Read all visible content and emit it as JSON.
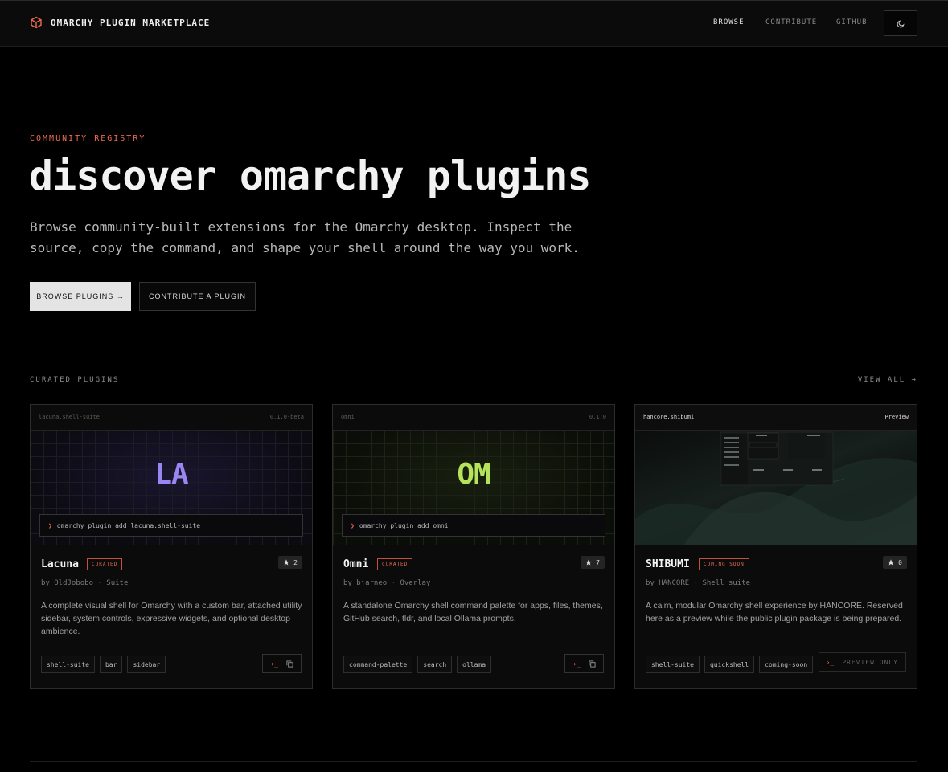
{
  "header": {
    "brand": "OMARCHY PLUGIN MARKETPLACE",
    "nav": [
      "BROWSE",
      "CONTRIBUTE",
      "GITHUB"
    ],
    "theme_toggle_icon": "moon-icon"
  },
  "hero": {
    "eyebrow": "COMMUNITY REGISTRY",
    "title": "discover omarchy plugins",
    "subtitle": "Browse community-built extensions for the Omarchy desktop. Inspect the source, copy the command, and shape your shell around the way you work.",
    "primary_button": "BROWSE PLUGINS →",
    "secondary_button": "CONTRIBUTE A PLUGIN"
  },
  "section": {
    "label": "CURATED PLUGINS",
    "view_all": "VIEW ALL →"
  },
  "plugins": [
    {
      "id": "lacuna.shell-suite",
      "version": "0.1.0-beta",
      "monogram": "LA",
      "monogram_color": "#9a86f2",
      "command": "omarchy plugin add lacuna.shell-suite",
      "prompt": "❯",
      "name": "Lacuna",
      "badge": "CURATED",
      "stars": "2",
      "byline": "by OldJobobo · Suite",
      "description": "A complete visual shell for Omarchy with a custom bar, attached utility sidebar, system controls, expressive widgets, and optional desktop ambience.",
      "tags": [
        "shell-suite",
        "bar",
        "sidebar"
      ],
      "action_terminal": "›_",
      "action_copy_icon": "copy-icon"
    },
    {
      "id": "omni",
      "version": "0.1.0",
      "monogram": "OM",
      "monogram_color": "#b5e35a",
      "command": "omarchy plugin add omni",
      "prompt": "❯",
      "name": "Omni",
      "badge": "CURATED",
      "stars": "7",
      "byline": "by bjarneo · Overlay",
      "description": "A standalone Omarchy shell command palette for apps, files, themes, GitHub search, tldr, and local Ollama prompts.",
      "tags": [
        "command-palette",
        "search",
        "ollama"
      ],
      "action_terminal": "›_",
      "action_copy_icon": "copy-icon"
    },
    {
      "id": "hancore.shibumi",
      "version": "Preview",
      "name": "SHIBUMI",
      "badge": "COMING SOON",
      "stars": "0",
      "byline": "by HANCORE · Shell suite",
      "description": "A calm, modular Omarchy shell experience by HANCORE. Reserved here as a preview while the public plugin package is being prepared.",
      "tags": [
        "shell-suite",
        "quickshell",
        "coming-soon"
      ],
      "action_terminal": "›_",
      "action_label": "PREVIEW ONLY"
    }
  ]
}
